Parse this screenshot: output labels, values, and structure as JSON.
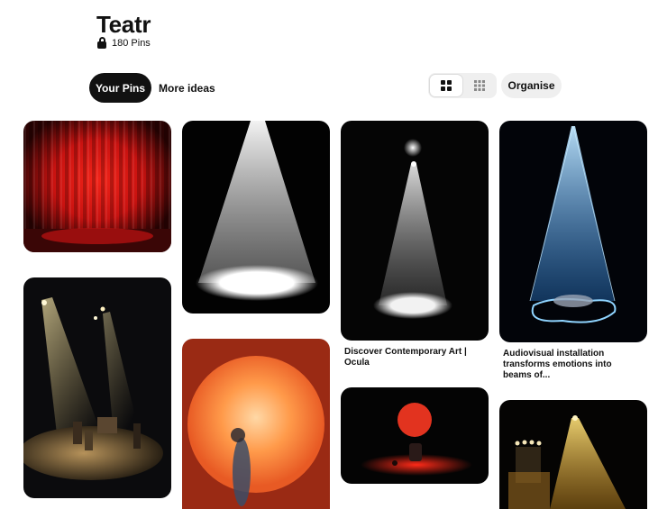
{
  "board": {
    "title": "Teatr",
    "pin_count": "180 Pins",
    "privacy_icon": "lock-icon"
  },
  "tabs": [
    {
      "label": "Your Pins",
      "active": true
    },
    {
      "label": "More ideas",
      "active": false
    }
  ],
  "toolbar": {
    "view_modes": [
      {
        "icon": "grid-large-icon",
        "active": true
      },
      {
        "icon": "grid-small-icon",
        "active": false
      }
    ],
    "organise_label": "Organise"
  },
  "pins": [
    {
      "subject": "red stage curtain under spotlight"
    },
    {
      "subject": "white spotlight beam on black"
    },
    {
      "subject": "spotlight beam from lamp onto dark stage",
      "caption_lines": [
        "Discover Contemporary Art |",
        "Ocula"
      ]
    },
    {
      "subject": "blue light cone over reclining figure",
      "caption_lines": [
        "Audiovisual installation",
        "transforms emotions into",
        "beams of..."
      ]
    },
    {
      "subject": "theatre stage with performers under spotlights"
    },
    {
      "subject": "figure against large orange sun disc"
    },
    {
      "subject": "red moon over red-lit stage figure"
    },
    {
      "subject": "yellow spotlight on stage with lamps"
    }
  ],
  "colors": {
    "accent": "#111111",
    "chip_background": "#efefef",
    "page_background": "#ffffff"
  }
}
